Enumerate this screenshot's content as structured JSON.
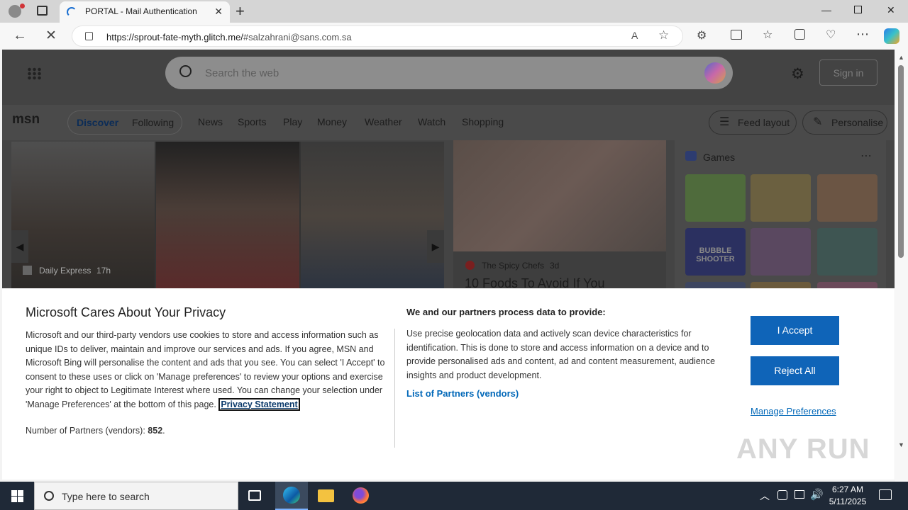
{
  "browser": {
    "tab_title": "PORTAL - Mail Authentication",
    "url_domain": "https://sprout-fate-myth.glitch.me/",
    "url_hash": "#salzahrani@sans.com.sa"
  },
  "msn": {
    "search_placeholder": "Search the web",
    "sign_in": "Sign in",
    "logo": "msn",
    "nav": {
      "discover": "Discover",
      "following": "Following",
      "news": "News",
      "sports": "Sports",
      "play": "Play",
      "money": "Money",
      "weather": "Weather",
      "watch": "Watch",
      "shopping": "Shopping",
      "feed_layout": "Feed layout",
      "personalise": "Personalise"
    },
    "hero": {
      "source": "Daily Express",
      "age": "17h"
    },
    "card2": {
      "source": "The Spicy Chefs",
      "age": "3d",
      "headline": "10 Foods To Avoid If You"
    },
    "games": {
      "title": "Games",
      "tile_text": "BUBBLE SHOOTER"
    }
  },
  "privacy": {
    "title": "Microsoft Cares About Your Privacy",
    "body": "Microsoft and our third-party vendors use cookies to store and access information such as unique IDs to deliver, maintain and improve our services and ads. If you agree, MSN and Microsoft Bing will personalise the content and ads that you see. You can select 'I Accept' to consent to these uses or click on 'Manage preferences' to review your options and exercise your right to object to Legitimate Interest where used.  You can change your selection under 'Manage Preferences' at the bottom of this page.",
    "privacy_link": "Privacy Statement",
    "partners_label": "Number of Partners (vendors):",
    "partners_count": "852",
    "right_heading": "We and our partners process data to provide:",
    "right_body": "Use precise geolocation data and actively scan device characteristics for identification. This is done to store and access information on a device and to provide personalised ads and content, ad and content measurement, audience insights and product development.",
    "list_link": "List of Partners (vendors)",
    "accept": "I Accept",
    "reject": "Reject All",
    "manage": "Manage Preferences"
  },
  "taskbar": {
    "search_placeholder": "Type here to search",
    "time": "6:27 AM",
    "date": "5/11/2025"
  },
  "watermark": "ANY RUN",
  "colors": {
    "accent": "#0f64b8",
    "link": "#0067b8",
    "taskbar": "#1f2937"
  }
}
